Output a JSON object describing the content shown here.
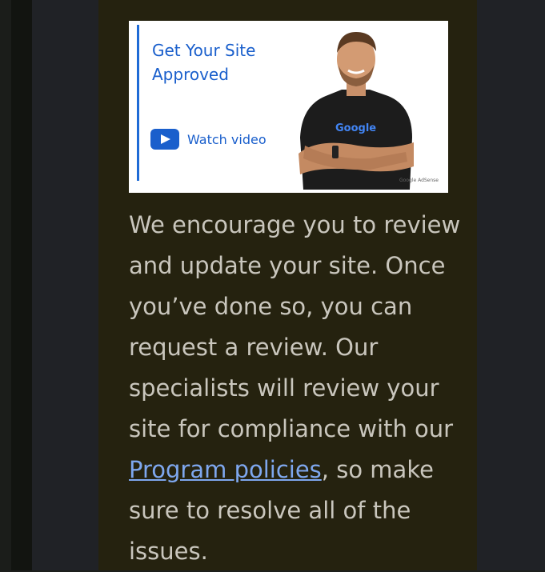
{
  "banner": {
    "title": "Get Your Site Approved",
    "cta_label": "Watch video",
    "shirt_brand": "Google",
    "corner_brand": "Google AdSense"
  },
  "message": {
    "before_link": "We encourage you to review and update your site. Once you’ve done so, you can request a review. Our specialists will review your site for compliance with our ",
    "link_text": "Program policies",
    "after_link": ", so make sure to resolve all of the issues."
  },
  "colors": {
    "background": "#202226",
    "card": "#25220f",
    "body_text": "#c9c6bd",
    "link": "#7ea7ee",
    "banner_accent": "#1a5fcc"
  }
}
